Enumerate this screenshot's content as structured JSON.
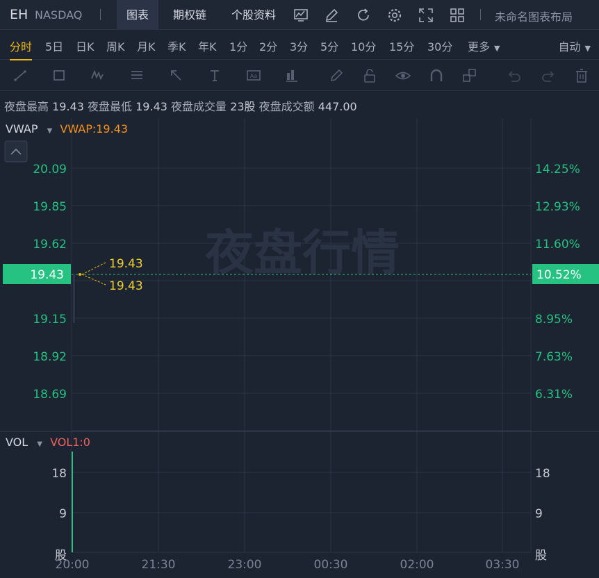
{
  "header": {
    "symbol": "EH",
    "exchange": "NASDAQ",
    "tabs": [
      "图表",
      "期权链",
      "个股资料"
    ],
    "active_tab": 0,
    "layout_label": "未命名图表布局"
  },
  "periods": {
    "items": [
      "分时",
      "5日",
      "日K",
      "周K",
      "月K",
      "季K",
      "年K",
      "1分",
      "2分",
      "3分",
      "5分",
      "10分",
      "15分",
      "30分",
      "更多"
    ],
    "active": 0,
    "mode_label": "自动"
  },
  "info": {
    "high_label": "夜盘最高",
    "high_value": "19.43",
    "low_label": "夜盘最低",
    "low_value": "19.43",
    "vol_label": "夜盘成交量",
    "vol_value": "23股",
    "amount_label": "夜盘成交额",
    "amount_value": "447.00"
  },
  "price_panel": {
    "indicator": "VWAP",
    "indicator_value": "VWAP:19.43",
    "watermark": "夜盘行情",
    "left_ticks": [
      "20.09",
      "19.85",
      "19.62",
      "19.15",
      "18.92",
      "18.69"
    ],
    "right_ticks": [
      "14.25%",
      "12.93%",
      "11.60%",
      "8.95%",
      "7.63%",
      "6.31%"
    ],
    "current_price": "19.43",
    "current_pct": "10.52%",
    "callouts": [
      "19.43",
      "19.43"
    ]
  },
  "volume_panel": {
    "indicator": "VOL",
    "indicator_value": "VOL1:0",
    "left_ticks": [
      "18",
      "9",
      "股"
    ],
    "right_ticks": [
      "18",
      "9",
      "股"
    ]
  },
  "x_axis": [
    "20:00",
    "21:30",
    "23:00",
    "00:30",
    "02:00",
    "03:30"
  ],
  "colors": {
    "accent": "#f0b90b",
    "up_green": "#26c281",
    "vwap_orange": "#f7931a",
    "vol_red": "#f0645c"
  }
}
